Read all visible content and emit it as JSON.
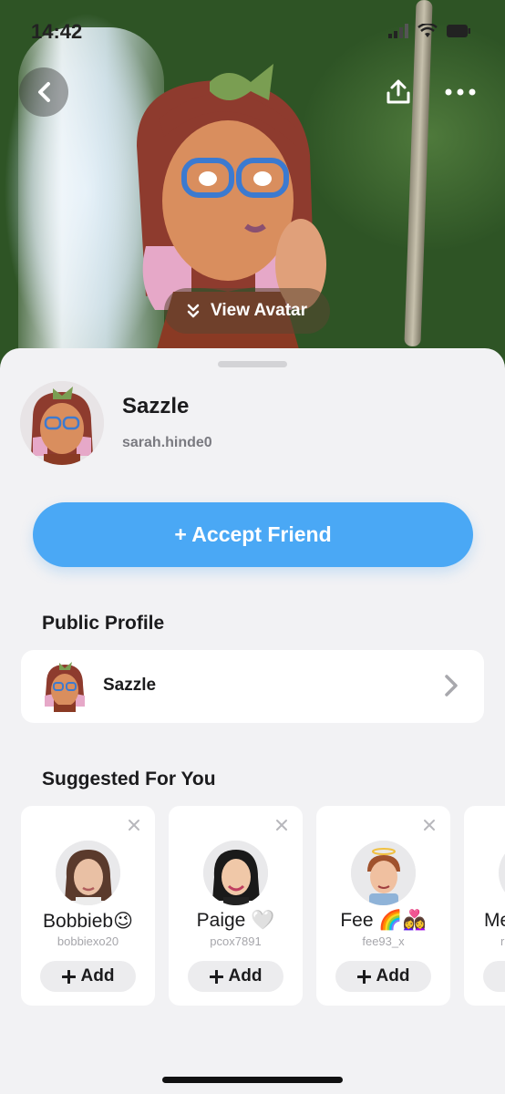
{
  "status_bar": {
    "time": "14:42"
  },
  "hero": {
    "view_avatar_label": "View Avatar"
  },
  "profile": {
    "display_name": "Sazzle",
    "username": "sarah.hinde0"
  },
  "actions": {
    "accept_label": "+ Accept Friend"
  },
  "public_profile": {
    "section_title": "Public Profile",
    "name": "Sazzle"
  },
  "suggested": {
    "section_title": "Suggested For You",
    "add_label": "Add",
    "cards": [
      {
        "name": "Bobbieb😉",
        "username": "bobbiexo20"
      },
      {
        "name": "Paige 🤍",
        "username": "pcox7891"
      },
      {
        "name": "Fee 🌈👩‍❤️‍👩",
        "username": "fee93_x"
      },
      {
        "name": "Me",
        "username": "r"
      }
    ]
  },
  "colors": {
    "accent_blue": "#4aa8f5",
    "sheet_bg": "#f2f2f4"
  }
}
